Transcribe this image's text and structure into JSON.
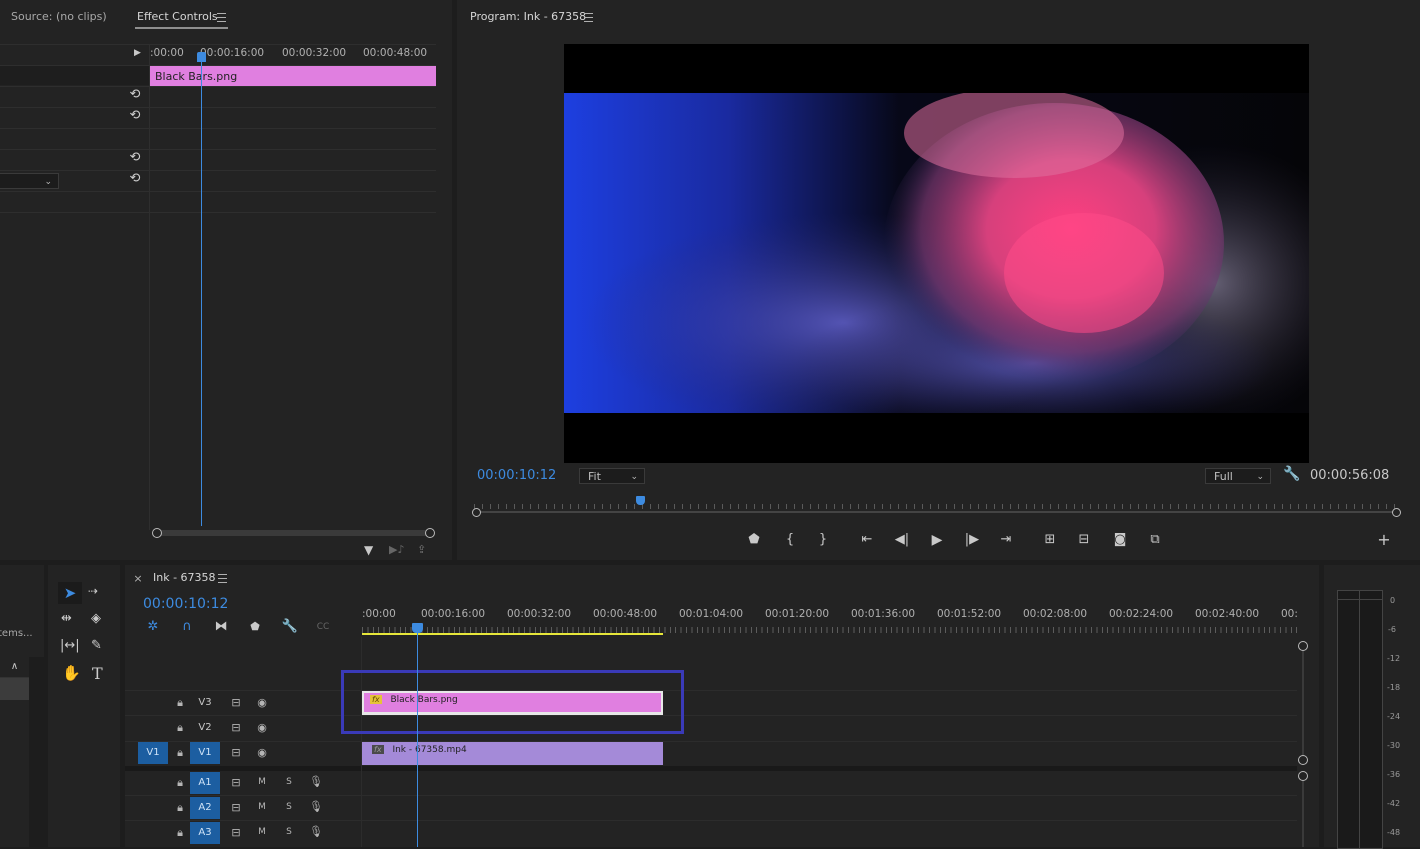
{
  "source_panel": {
    "tab_label": "Source: (no clips)"
  },
  "effect_controls": {
    "tab_label": "Effect Controls",
    "ruler_labels": [
      ":00:00",
      "00:00:16:00",
      "00:00:32:00",
      "00:00:48:00"
    ],
    "clip_label": "Black Bars.png"
  },
  "program_monitor": {
    "tab_label": "Program: Ink - 67358",
    "current_time": "00:00:10:12",
    "fit_value": "Fit",
    "resolution_value": "Full",
    "duration": "00:00:56:08",
    "playhead_fraction": 0.18
  },
  "timeline": {
    "sequence_name": "Ink - 67358",
    "close_glyph": "×",
    "current_time": "00:00:10:12",
    "ruler_labels": [
      ":00:00",
      "00:00:16:00",
      "00:00:32:00",
      "00:00:48:00",
      "00:01:04:00",
      "00:01:20:00",
      "00:01:36:00",
      "00:01:52:00",
      "00:02:08:00",
      "00:02:24:00",
      "00:02:40:00",
      "00:"
    ],
    "video_tracks": [
      {
        "name": "V3"
      },
      {
        "name": "V2"
      },
      {
        "name": "V1",
        "source_patch": "V1"
      }
    ],
    "audio_tracks": [
      {
        "name": "A1",
        "mute": "M",
        "solo": "S"
      },
      {
        "name": "A2",
        "mute": "M",
        "solo": "S"
      },
      {
        "name": "A3",
        "mute": "M",
        "solo": "S"
      }
    ],
    "clips": {
      "v3": {
        "label": "Black Bars.png",
        "fx": "fx"
      },
      "v1": {
        "label": "Ink - 67358.mp4",
        "fx": "fx"
      }
    }
  },
  "project_panel": {
    "items_fragment": "tems..."
  },
  "audio_meter": {
    "top_label": "0",
    "scale": [
      "-6",
      "-12",
      "-18",
      "-24",
      "-30",
      "-36",
      "-42",
      "-48"
    ]
  },
  "colors": {
    "accent_blue": "#3d8be0",
    "clip_pink": "#e07fe0",
    "clip_purple": "#a48ad8",
    "highlight_box": "#3a3ab8"
  }
}
